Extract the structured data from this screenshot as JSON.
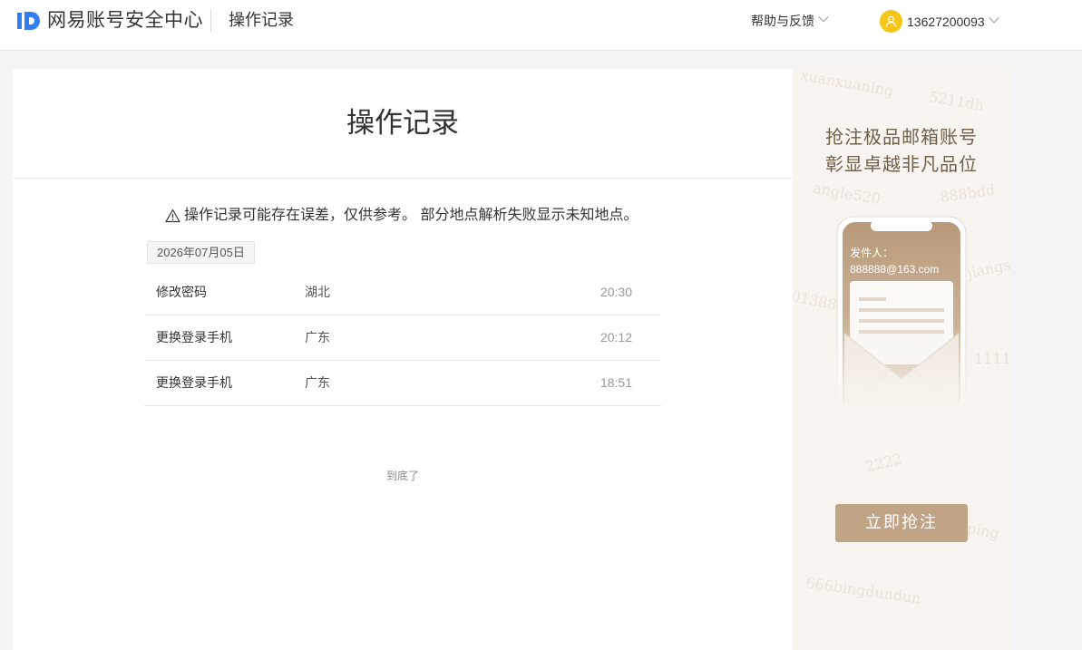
{
  "header": {
    "brand": "网易账号安全中心",
    "section": "操作记录",
    "help_label": "帮助与反馈",
    "user_phone": "13627200093"
  },
  "main": {
    "title": "操作记录",
    "notice": "操作记录可能存在误差，仅供参考。 部分地点解析失败显示未知地点。",
    "date": "2026年07月05日",
    "records": [
      {
        "action": "修改密码",
        "location": "湖北",
        "time": "20:30"
      },
      {
        "action": "更换登录手机",
        "location": "广东",
        "time": "20:12"
      },
      {
        "action": "更换登录手机",
        "location": "广东",
        "time": "18:51"
      }
    ],
    "end_text": "到底了"
  },
  "ad": {
    "line1": "抢注极品邮箱账号",
    "line2": "彰显卓越非凡品位",
    "sender_label": "发件人：",
    "sender_email": "888888@163.com",
    "button_label": "立即抢注",
    "watermarks": [
      "5211dh",
      "angle520",
      "888bdd",
      "01388",
      "jiangsu",
      "2222",
      "1111",
      "ping",
      "666bingdundun",
      "xuanxuanlng"
    ]
  },
  "colors": {
    "accent_blue": "#2f7ff0",
    "avatar_yellow": "#f5c518",
    "ad_bg": "#f8f4ef",
    "ad_button": "#c0a485"
  }
}
